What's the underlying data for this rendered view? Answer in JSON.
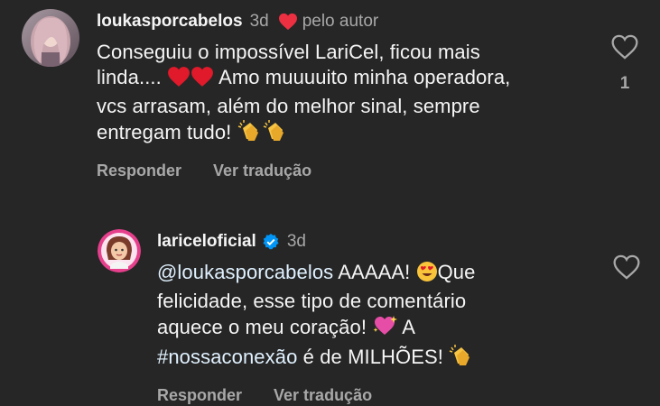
{
  "comments": [
    {
      "username": "loukasporcabelos",
      "time": "3d",
      "author_label": "pelo autor",
      "text_line1": "Conseguiu o impossível LariCel, ficou mais",
      "text_line2a": "linda....",
      "text_line2b": "Amo muuuuito minha operadora,",
      "text_line3": "vcs arrasam, além do melhor sinal, sempre",
      "text_line4": "entregam tudo!",
      "reply_label": "Responder",
      "translate_label": "Ver tradução",
      "like_count": "1"
    },
    {
      "username": "lariceloficial",
      "time": "3d",
      "mention": "@loukasporcabelos",
      "text_line1b": "AAAAA!",
      "text_line1c": "Que",
      "text_line2": "felicidade, esse tipo de comentário",
      "text_line3a": "aquece o meu coração!",
      "text_line3b": "A",
      "hashtag": "#nossaconexão",
      "text_line4b": "é de MILHÕES!",
      "reply_label": "Responder",
      "translate_label": "Ver tradução"
    }
  ],
  "colors": {
    "background": "#262626",
    "primary_text": "#f5f5f5",
    "secondary_text": "#a8a8a8",
    "heart_red": "#ed2f42",
    "verified_blue": "#0095f6",
    "link": "#e0f1ff"
  },
  "icons": [
    "avatar-image",
    "author-heart-icon",
    "verified-badge-icon",
    "heart-outline-icon",
    "red-heart-emoji",
    "clapping-hands-emoji",
    "heart-eyes-emoji",
    "sparkling-heart-emoji"
  ]
}
